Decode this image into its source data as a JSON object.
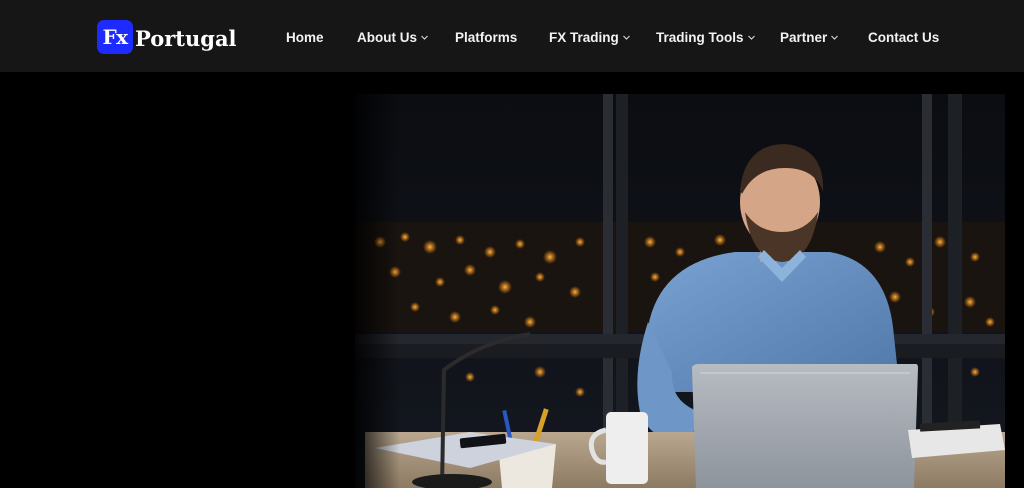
{
  "brand": {
    "badge": "Fx",
    "name": "Portugal",
    "badge_color": "#1d2bff"
  },
  "nav": {
    "items": [
      {
        "label": "Home",
        "has_dropdown": false
      },
      {
        "label": "About Us",
        "has_dropdown": true
      },
      {
        "label": "Platforms",
        "has_dropdown": false
      },
      {
        "label": "FX Trading",
        "has_dropdown": true
      },
      {
        "label": "Trading Tools",
        "has_dropdown": true
      },
      {
        "label": "Partner",
        "has_dropdown": true
      },
      {
        "label": "Contact Us",
        "has_dropdown": false
      }
    ]
  },
  "colors": {
    "topbar": "#161616",
    "nav_text": "#f2f2f2",
    "background": "#000000"
  }
}
